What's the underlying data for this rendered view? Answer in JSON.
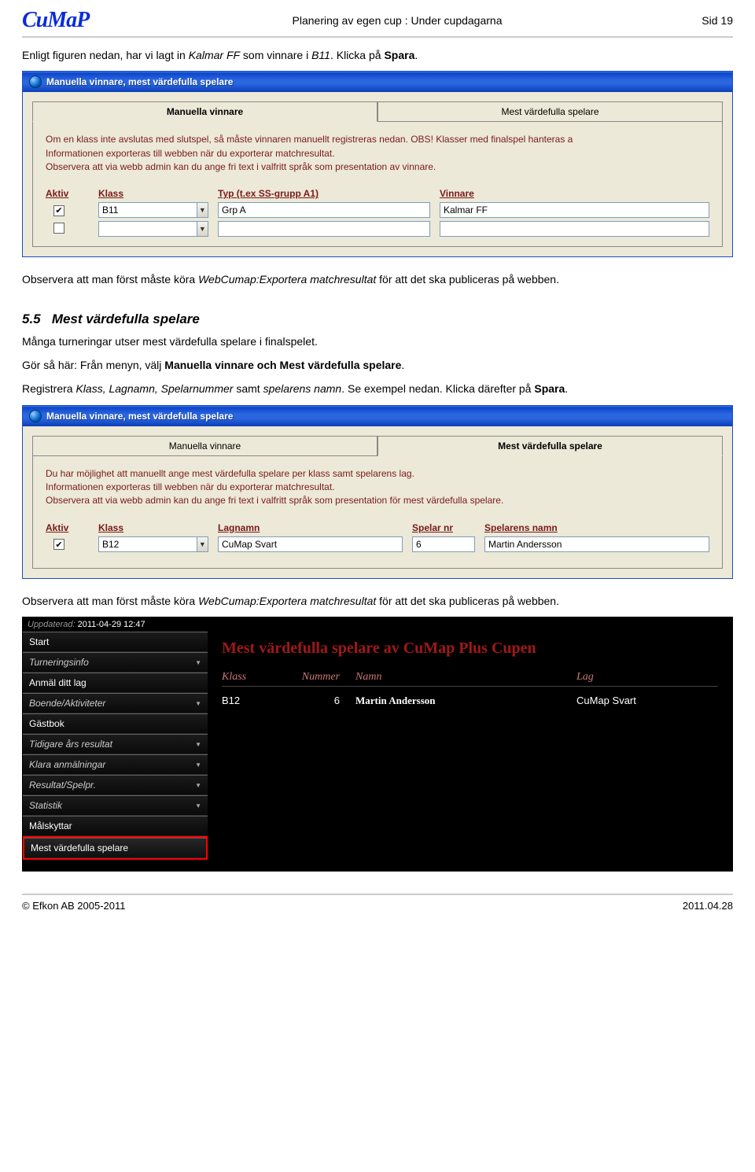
{
  "header": {
    "logo_text": "CuMaP",
    "title": "Planering av egen cup : Under cupdagarna",
    "page_label": "Sid 19"
  },
  "intro": {
    "line1_a": "Enligt figuren nedan, har vi lagt in ",
    "line1_em": "Kalmar FF",
    "line1_b": " som vinnare i ",
    "line1_em2": "B11",
    "line1_c": ". Klicka på ",
    "line1_strong": "Spara",
    "line1_d": "."
  },
  "dlg1": {
    "title": "Manuella vinnare, mest värdefulla spelare",
    "tab_active": "Manuella vinnare",
    "tab_inactive": "Mest värdefulla spelare",
    "info1": "Om en klass inte avslutas med slutspel, så måste vinnaren manuellt registreras nedan. OBS! Klasser med finalspel hanteras a",
    "info2": "Informationen exporteras till webben när du exporterar matchresultat.",
    "info3": "Observera att via webb admin kan du ange fri text i valfritt språk som presentation av vinnare.",
    "h_aktiv": "Aktiv",
    "h_klass": "Klass",
    "h_typ": "Typ (t.ex SS-grupp A1)",
    "h_vinn": "Vinnare",
    "r1": {
      "aktiv": true,
      "klass": "B11",
      "typ": "Grp A",
      "vinnare": "Kalmar FF"
    }
  },
  "mid": {
    "obs_a": "Observera att man först måste köra ",
    "obs_em": "WebCumap:Exportera matchresultat",
    "obs_b": " för att det ska publiceras på webben.",
    "sec_num": "5.5",
    "sec_title": "Mest värdefulla spelare",
    "p1": "Många turneringar utser mest värdefulla spelare i finalspelet.",
    "p2_a": "Gör så här: Från menyn, välj ",
    "p2_strong": "Manuella vinnare och Mest värdefulla spelare",
    "p2_b": ".",
    "p3_a": "Registrera ",
    "p3_em": "Klass, Lagnamn, Spelarnummer",
    "p3_b": " samt ",
    "p3_em2": "spelarens namn",
    "p3_c": ". Se exempel nedan. Klicka därefter på ",
    "p3_strong": "Spara",
    "p3_d": "."
  },
  "dlg2": {
    "title": "Manuella vinnare, mest värdefulla spelare",
    "tab_inactive": "Manuella vinnare",
    "tab_active": "Mest värdefulla spelare",
    "info1": "Du har möjlighet att manuellt ange mest värdefulla spelare per klass samt spelarens lag.",
    "info2": "Informationen exporteras till webben när du exporterar matchresultat.",
    "info3": "Observera att via webb admin kan du ange fri text i valfritt språk som presentation för mest värdefulla spelare.",
    "h_aktiv": "Aktiv",
    "h_klass": "Klass",
    "h_lag": "Lagnamn",
    "h_nr": "Spelar nr",
    "h_namn": "Spelarens namn",
    "r1": {
      "aktiv": true,
      "klass": "B12",
      "lag": "CuMap Svart",
      "nr": "6",
      "namn": "Martin Andersson"
    }
  },
  "obs2": {
    "a": "Observera att man först måste köra ",
    "em": "WebCumap:Exportera matchresultat",
    "b": " för att det ska publiceras på webben."
  },
  "web": {
    "upd_label": "Uppdaterad:",
    "upd_value": "2011-04-29 12:47",
    "nav": [
      {
        "label": "Start",
        "drop": false,
        "italic": false
      },
      {
        "label": "Turneringsinfo",
        "drop": true,
        "italic": true
      },
      {
        "label": "Anmäl ditt lag",
        "drop": false,
        "italic": false
      },
      {
        "label": "Boende/Aktiviteter",
        "drop": true,
        "italic": true
      },
      {
        "label": "Gästbok",
        "drop": false,
        "italic": false
      },
      {
        "label": "Tidigare års resultat",
        "drop": true,
        "italic": true
      },
      {
        "label": "Klara anmälningar",
        "drop": true,
        "italic": true
      },
      {
        "label": "Resultat/Spelpr.",
        "drop": true,
        "italic": true
      },
      {
        "label": "Statistik",
        "drop": true,
        "italic": true
      },
      {
        "label": "Målskyttar",
        "drop": false,
        "italic": false
      }
    ],
    "nav_highlight": "Mest värdefulla spelare",
    "title": "Mest värdefulla spelare av CuMap Plus Cupen",
    "cols": {
      "klass": "Klass",
      "num": "Nummer",
      "namn": "Namn",
      "lag": "Lag"
    },
    "row": {
      "klass": "B12",
      "num": "6",
      "namn": "Martin Andersson",
      "lag": "CuMap Svart"
    }
  },
  "footer": {
    "left": "© Efkon AB 2005-2011",
    "right": "2011.04.28"
  }
}
